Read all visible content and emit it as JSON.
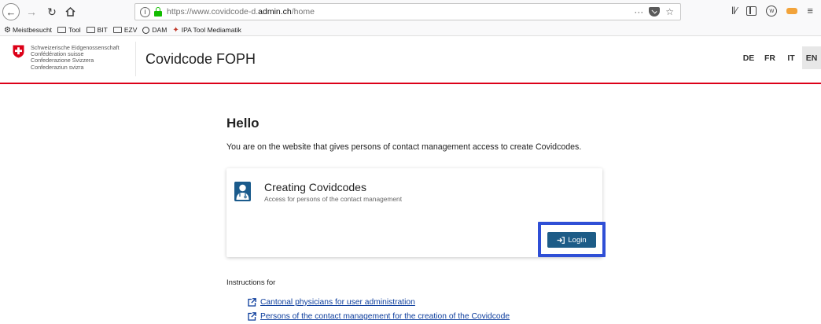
{
  "browser": {
    "url_prefix": "https://www.covidcode-d.",
    "url_domain": "admin.ch",
    "url_path": "/home",
    "url_menu": "···",
    "bookmarks": [
      {
        "label": "Meistbesucht",
        "icon": "gear-icon"
      },
      {
        "label": "Tool",
        "icon": "folder-icon"
      },
      {
        "label": "BIT",
        "icon": "folder-icon"
      },
      {
        "label": "EZV",
        "icon": "folder-icon"
      },
      {
        "label": "DAM",
        "icon": "globe-icon"
      },
      {
        "label": "IPA Tool Mediamatik",
        "icon": "ipa-icon"
      }
    ]
  },
  "header": {
    "confed_lines": [
      "Schweizerische Eidgenossenschaft",
      "Confédération suisse",
      "Confederazione Svizzera",
      "Confederaziun svizra"
    ],
    "app_title": "Covidcode FOPH",
    "languages": [
      "DE",
      "FR",
      "IT",
      "EN"
    ],
    "active_language": "EN",
    "accent_color": "#dc0018"
  },
  "main": {
    "greeting": "Hello",
    "intro": "You are on the website that gives persons of contact management access to create Covidcodes.",
    "card": {
      "title": "Creating Covidcodes",
      "subtitle": "Access for persons of the contact management",
      "login_label": "Login",
      "button_color": "#1d5c87",
      "highlight_color": "#2f4fd6"
    },
    "instructions_label": "Instructions for",
    "links": [
      "Cantonal physicians for user administration",
      "Persons of the contact management for the creation of the Covidcode"
    ]
  }
}
